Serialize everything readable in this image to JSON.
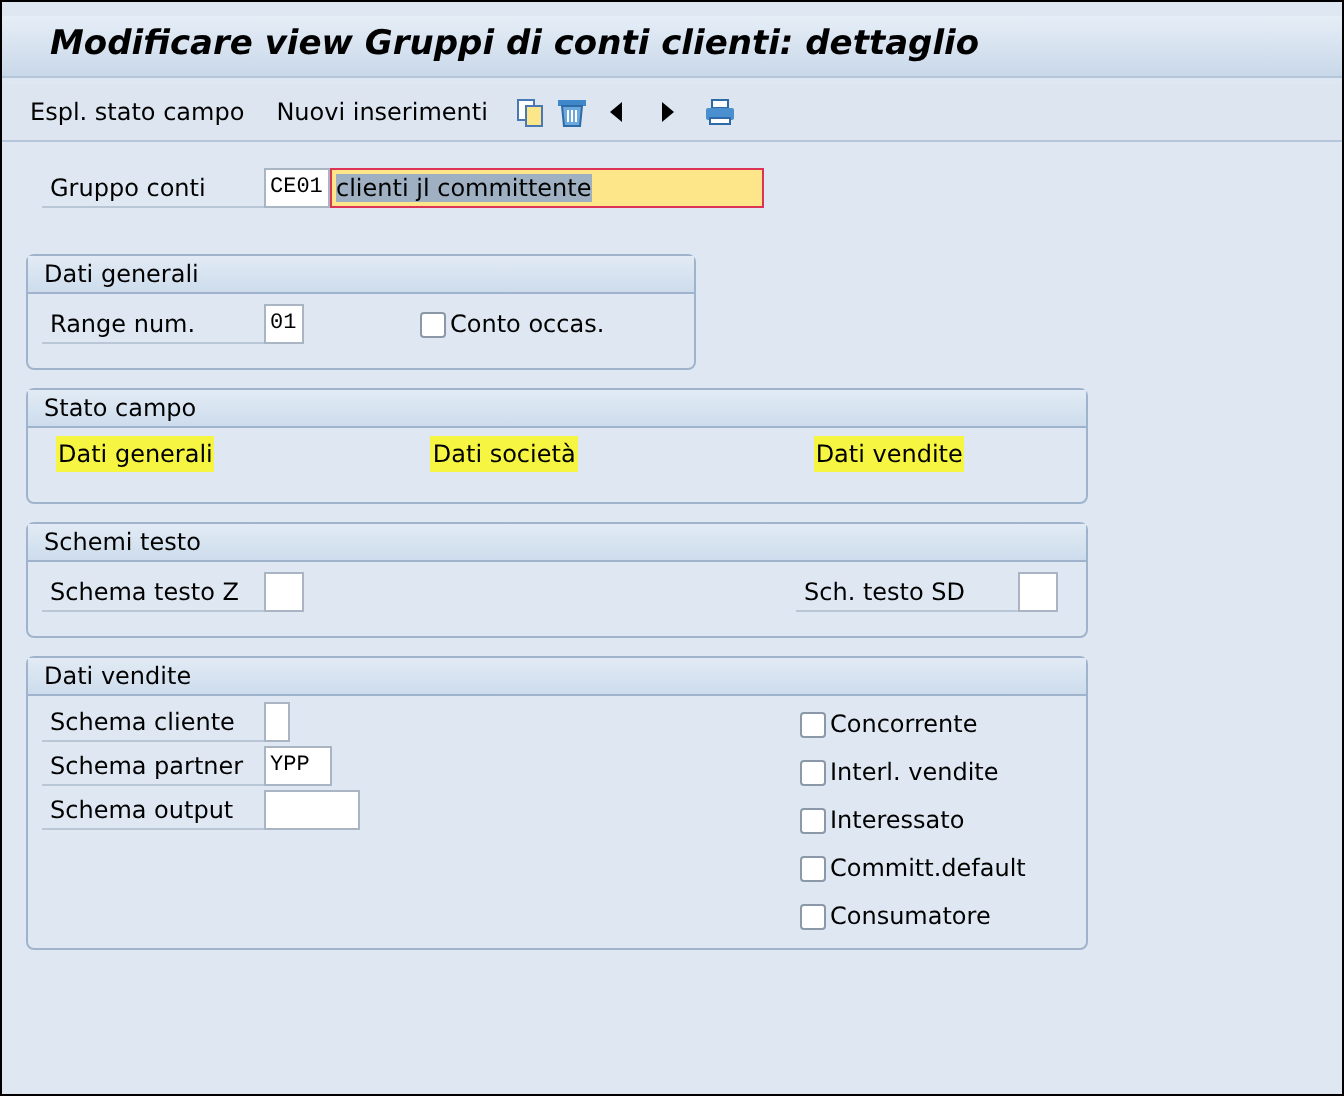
{
  "window": {
    "title": "Modificare view Gruppi di conti clienti: dettaglio"
  },
  "toolbar": {
    "buttons": [
      "Espl. stato campo",
      "Nuovi inserimenti"
    ]
  },
  "header": {
    "label": "Gruppo conti",
    "code": "CE01",
    "value": "clienti jl committente",
    "selected_text": true
  },
  "dati_generali": {
    "title": "Dati generali",
    "range_label": "Range num.",
    "range_value": "01",
    "checkbox": {
      "label": "Conto occas.",
      "checked": false
    }
  },
  "stato_campo": {
    "title": "Stato campo",
    "links": [
      {
        "label": "Dati generali",
        "highlighted": true
      },
      {
        "label": "Dati società",
        "highlighted": true
      },
      {
        "label": "Dati vendite",
        "highlighted": true
      }
    ]
  },
  "schemi_testo": {
    "title": "Schemi testo",
    "fields": [
      {
        "label": "Schema testo Z"
      },
      {
        "label": "Sch. testo SD"
      }
    ]
  },
  "dati_vendite": {
    "title": "Dati vendite",
    "fields": [
      {
        "label": "Schema cliente"
      },
      {
        "label": "Schema partner",
        "value": "YPP"
      },
      {
        "label": "Schema output"
      }
    ],
    "checkboxes": [
      {
        "label": "Concorrente",
        "checked": false
      },
      {
        "label": "Interl. vendite",
        "checked": false
      },
      {
        "label": "Interessato",
        "checked": false
      },
      {
        "label": "Committ.default",
        "checked": false
      },
      {
        "label": "Consumatore",
        "checked": false
      }
    ]
  }
}
